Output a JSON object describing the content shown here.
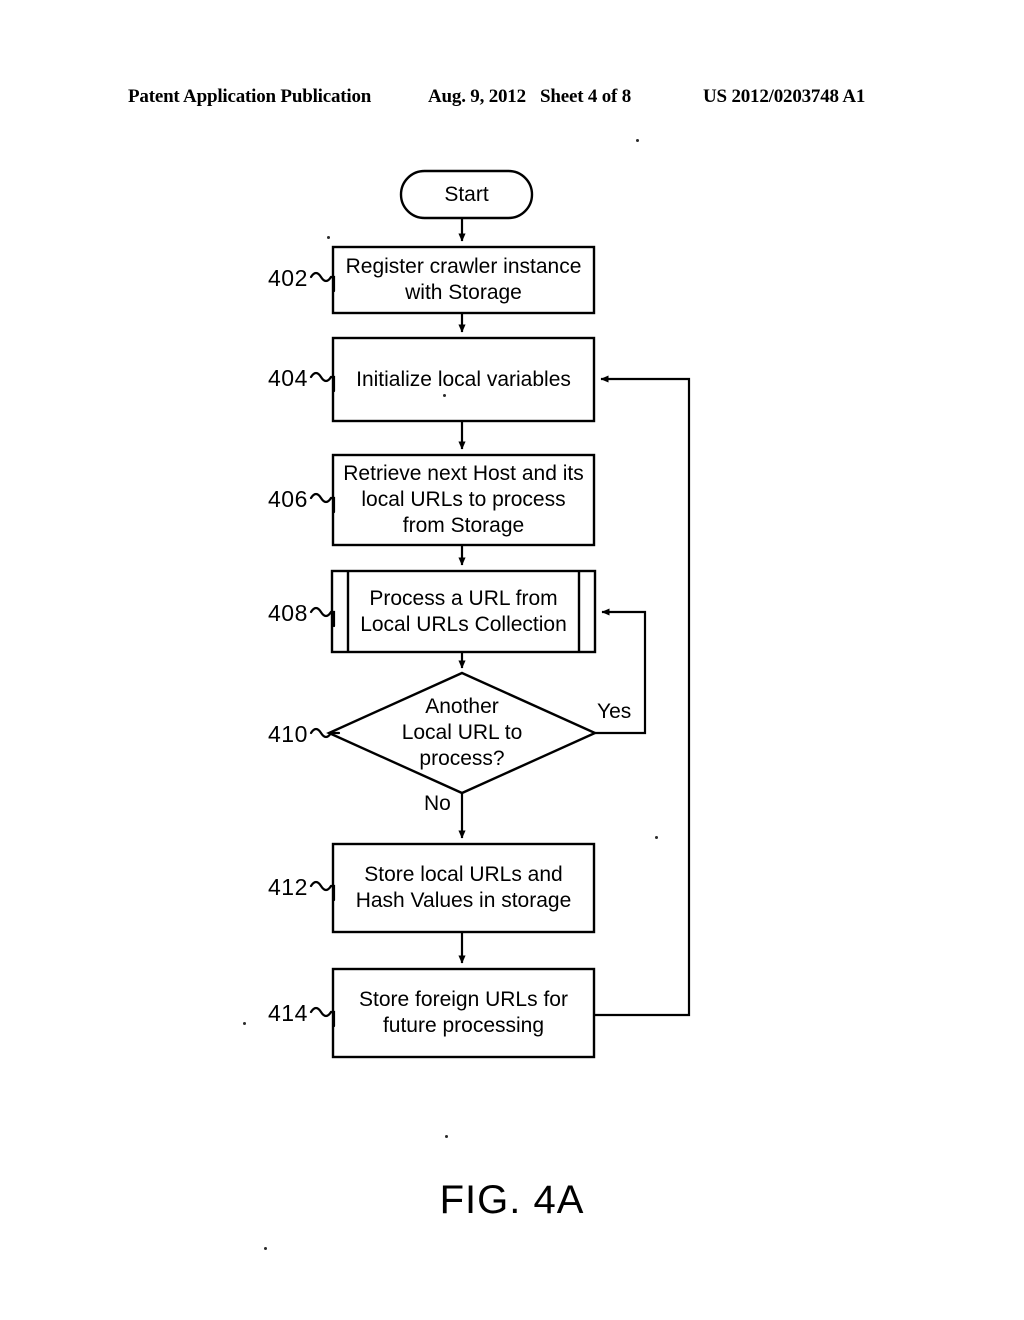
{
  "header": {
    "publication": "Patent Application Publication",
    "date": "Aug. 9, 2012",
    "sheet": "Sheet 4 of 8",
    "patent_number": "US 2012/0203748 A1"
  },
  "figure": {
    "caption": "FIG. 4A",
    "nodes": [
      {
        "id": "start",
        "shape": "terminator",
        "label": "Start",
        "ref": ""
      },
      {
        "id": "n402",
        "shape": "process",
        "label": "Register crawler instance\nwith Storage",
        "ref": "402"
      },
      {
        "id": "n404",
        "shape": "process",
        "label": "Initialize local variables",
        "ref": "404"
      },
      {
        "id": "n406",
        "shape": "process",
        "label": "Retrieve next Host and its\nlocal URLs to process\nfrom Storage",
        "ref": "406"
      },
      {
        "id": "n408",
        "shape": "predefined-process",
        "label": "Process a URL from\nLocal URLs Collection",
        "ref": "408"
      },
      {
        "id": "n410",
        "shape": "decision",
        "label": "Another\nLocal URL to\nprocess?",
        "ref": "410"
      },
      {
        "id": "n412",
        "shape": "process",
        "label": "Store local URLs and\nHash Values in storage",
        "ref": "412"
      },
      {
        "id": "n414",
        "shape": "process",
        "label": "Store foreign URLs for\nfuture processing",
        "ref": "414"
      }
    ],
    "edge_labels": {
      "yes": "Yes",
      "no": "No"
    },
    "colors": {
      "stroke": "#000000",
      "background": "#ffffff"
    }
  }
}
